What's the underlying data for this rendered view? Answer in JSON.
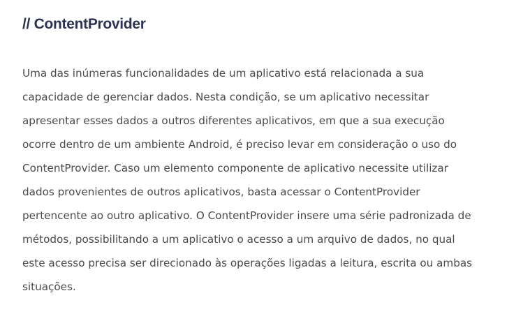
{
  "article": {
    "heading": "// ContentProvider",
    "paragraph_lines": [
      "Uma das inúmeras funcionalidades de um aplicativo está relacionada a sua",
      "capacidade de gerenciar dados. Nesta condição, se um aplicativo necessitar",
      "apresentar esses dados a outros diferentes aplicativos, em que a sua execução",
      "ocorre dentro de um ambiente Android, é preciso levar em consideração o uso do",
      "ContentProvider. Caso um elemento componente de aplicativo necessite utilizar",
      "dados provenientes de outros aplicativos, basta acessar o ContentProvider",
      "pertencente ao outro aplicativo. O ContentProvider insere uma série padronizada de",
      "métodos, possibilitando a um aplicativo o acesso a um arquivo de dados, no qual",
      "este acesso precisa ser direcionado às operações ligadas a leitura, escrita ou ambas",
      "situações."
    ]
  },
  "colors": {
    "heading": "#2d3250",
    "body_text": "#4a4a4a",
    "background": "#ffffff"
  }
}
